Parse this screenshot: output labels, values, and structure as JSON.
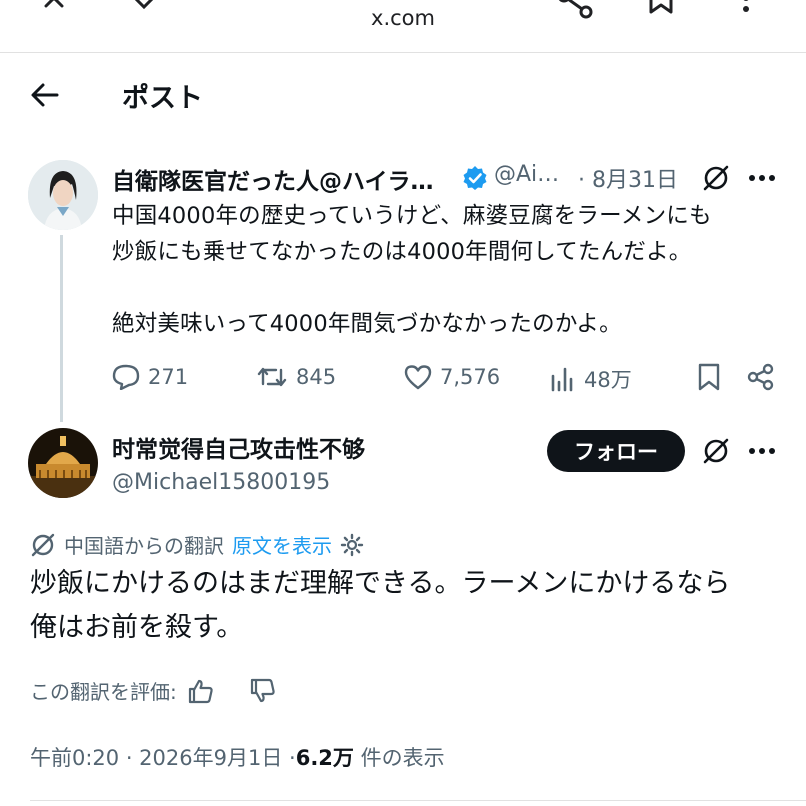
{
  "browser": {
    "url": "x.com"
  },
  "header": {
    "title": "ポスト"
  },
  "quoted_post": {
    "display_name": "自衛隊医官だった人@ハイラ…",
    "handle": "@Ai…",
    "date": "· 8月31日",
    "lines": [
      "中国4000年の歴史っていうけど、麻婆豆腐をラーメンにも",
      "炒飯にも乗せてなかったのは4000年間何してたんだよ。",
      "絶対美味いって4000年間気づかなかったのかよ。"
    ],
    "stats": {
      "replies": "271",
      "reposts": "845",
      "likes": "7,576",
      "views": "48万"
    }
  },
  "reply": {
    "display_name": "时常觉得自己攻击性不够",
    "handle": "@Michael15800195",
    "follow_label": "フォロー",
    "translation_label": "中国語からの翻訳",
    "show_original": "原文を表示",
    "lines": [
      "炒飯にかけるのはまだ理解できる。ラーメンにかけるなら",
      "俺はお前を殺す。"
    ],
    "rate_label": "この翻訳を評価:",
    "time": "午前0:20 · 2026年9月1日 · ",
    "views_count": "6.2万",
    "views_suffix": " 件の表示"
  },
  "colors": {
    "text": "#0f1419",
    "secondary": "#536471",
    "link": "#1d9bf0",
    "verified": "#1d9bf0",
    "thread_line": "#cfd9de"
  },
  "icons": [
    "close-icon",
    "chevron-down-icon",
    "share-icon",
    "bookmark-icon",
    "more-vert-icon",
    "back-arrow-icon",
    "verified-badge-icon",
    "grok-icon",
    "more-horizontal-icon",
    "reply-icon",
    "repost-icon",
    "like-icon",
    "views-icon",
    "translate-icon",
    "settings-icon",
    "thumbs-up-icon",
    "thumbs-down-icon"
  ]
}
